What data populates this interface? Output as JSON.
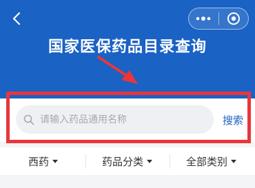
{
  "header": {
    "title": "国家医保药品目录查询",
    "bg_color": "#1a62c4",
    "back_icon": "chevron-left-icon",
    "more_icon": "more-dots-icon",
    "close_icon": "target-circle-icon"
  },
  "search": {
    "placeholder": "请输入药品通用名称",
    "value": "",
    "button_label": "搜索",
    "icon": "search-icon"
  },
  "filters": [
    {
      "label": "西药"
    },
    {
      "label": "药品分类"
    },
    {
      "label": "全部类别"
    }
  ],
  "annotation": {
    "color": "#e8363b"
  }
}
